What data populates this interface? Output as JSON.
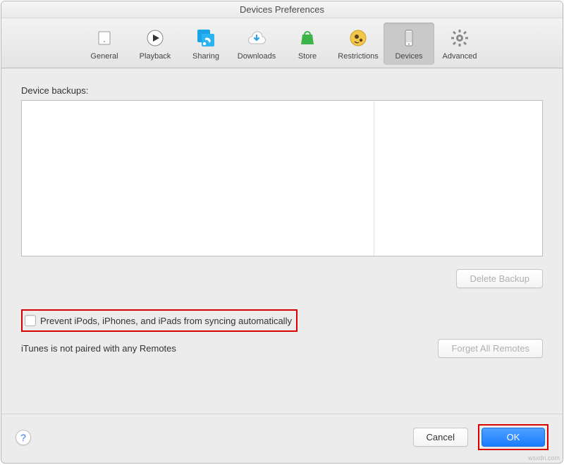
{
  "window_title": "Devices Preferences",
  "toolbar": [
    {
      "key": "general",
      "label": "General"
    },
    {
      "key": "playback",
      "label": "Playback"
    },
    {
      "key": "sharing",
      "label": "Sharing"
    },
    {
      "key": "downloads",
      "label": "Downloads"
    },
    {
      "key": "store",
      "label": "Store"
    },
    {
      "key": "restrictions",
      "label": "Restrictions"
    },
    {
      "key": "devices",
      "label": "Devices"
    },
    {
      "key": "advanced",
      "label": "Advanced"
    }
  ],
  "section": {
    "backups_label": "Device backups:",
    "delete_backup": "Delete Backup",
    "prevent_sync": "Prevent iPods, iPhones, and iPads from syncing automatically",
    "remotes_status": "iTunes is not paired with any Remotes",
    "forget_remotes": "Forget All Remotes"
  },
  "footer": {
    "help": "?",
    "cancel": "Cancel",
    "ok": "OK"
  },
  "watermark": "wsxdn.com"
}
